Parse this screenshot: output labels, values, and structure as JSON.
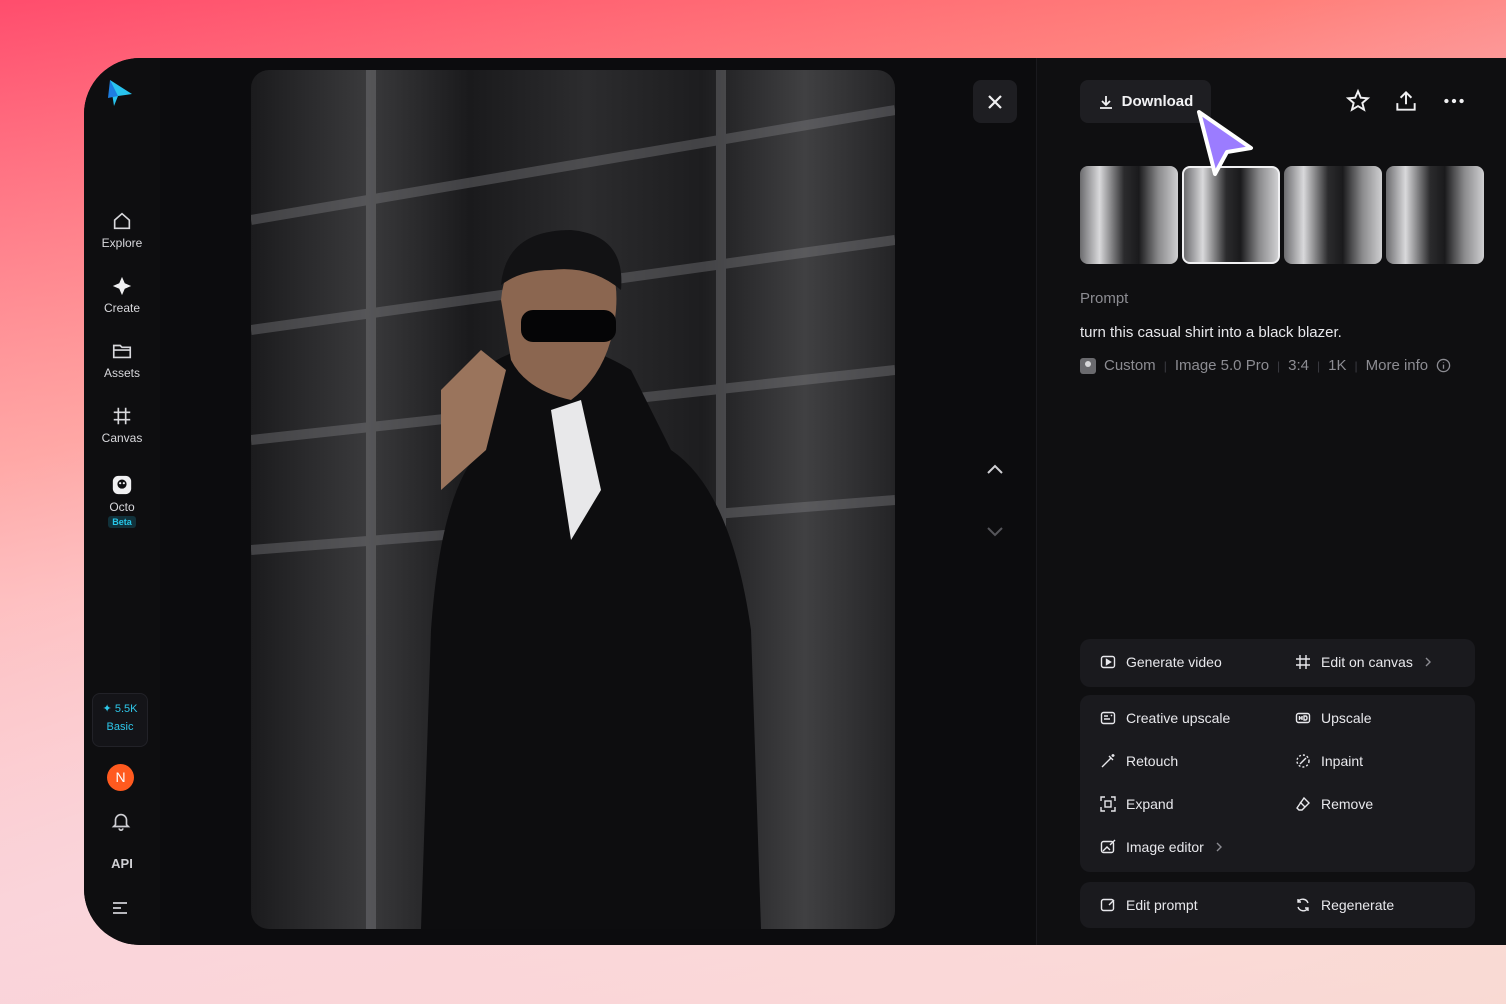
{
  "sidebar": {
    "items": [
      {
        "label": "Explore",
        "icon": "home-icon"
      },
      {
        "label": "Create",
        "icon": "sparkle-icon"
      },
      {
        "label": "Assets",
        "icon": "folder-icon"
      },
      {
        "label": "Canvas",
        "icon": "canvas-grid-icon"
      },
      {
        "label": "Octo",
        "icon": "octo-icon",
        "badge": "Beta"
      }
    ],
    "credits": {
      "amount": "✦ 5.5K",
      "plan": "Basic"
    },
    "avatar_initial": "N",
    "api_label": "API"
  },
  "panel": {
    "download_label": "Download",
    "prompt_label": "Prompt",
    "prompt_text": "turn this casual shirt into a black blazer.",
    "meta": [
      "Custom",
      "Image 5.0 Pro",
      "3:4",
      "1K",
      "More info"
    ],
    "actions_top": [
      "Generate video",
      "Edit on canvas"
    ],
    "actions_mid": [
      "Creative upscale",
      "Upscale",
      "Retouch",
      "Inpaint",
      "Expand",
      "Remove",
      "Image editor"
    ],
    "actions_bottom": [
      "Edit prompt",
      "Regenerate"
    ]
  },
  "colors": {
    "accent_cyan": "#2ec8ea",
    "cursor_purple": "#9b7cff",
    "avatar_orange": "#ff5a1f"
  }
}
